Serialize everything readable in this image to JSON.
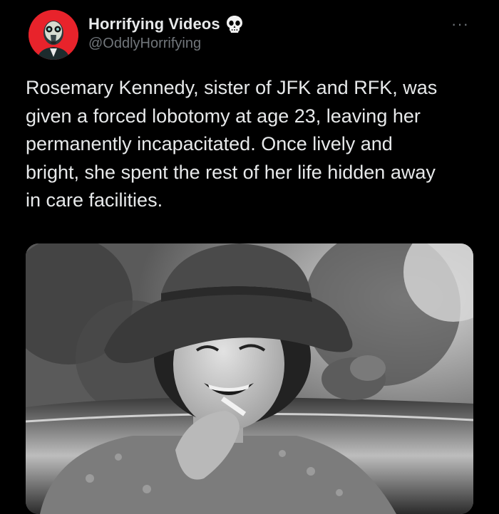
{
  "author": {
    "display_name": "Horrifying Videos",
    "handle": "@OddlyHorrifying",
    "badge_icon": "skull-icon",
    "avatar_bg": "#e8232b"
  },
  "tweet": {
    "text": "Rosemary Kennedy, sister of JFK and RFK, was\ngiven a forced lobotomy at age 23, leaving her\npermanently incapacitated. Once lively and\nbright, she spent the rest of her life hidden away\nin care facilities."
  },
  "media": {
    "kind": "black-and-white photograph"
  },
  "icons": {
    "more": "more-options-icon"
  }
}
